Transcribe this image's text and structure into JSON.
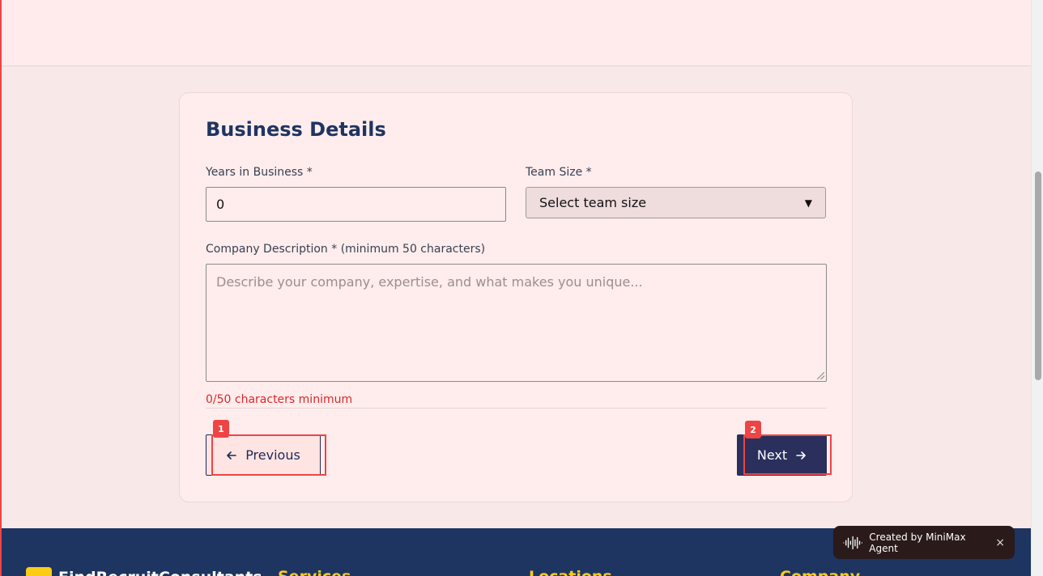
{
  "form": {
    "title": "Business Details",
    "years_label": "Years in Business *",
    "years_value": "0",
    "team_label": "Team Size *",
    "team_selected": "Select team size",
    "desc_label": "Company Description * (minimum 50 characters)",
    "desc_placeholder": "Describe your company, expertise, and what makes you unique...",
    "counter": "0/50 characters minimum",
    "prev_label": "Previous",
    "next_label": "Next",
    "prev_tag": "1",
    "next_tag": "2"
  },
  "footer": {
    "brand": "FindRecruitConsultants",
    "col1": "Services",
    "col2": "Locations",
    "col3": "Company"
  },
  "badge": {
    "text": "Created by MiniMax Agent",
    "close": "×"
  },
  "icons": {
    "prev": "arrow-left-icon",
    "next": "arrow-right-icon",
    "badge": "waveform-icon"
  },
  "colors": {
    "title": "#1f3461",
    "primary_button": "#2a2f5c",
    "error": "#dc2626",
    "highlight": "#ef4444",
    "footer": "#1e3461",
    "footer_accent": "#facc15"
  }
}
